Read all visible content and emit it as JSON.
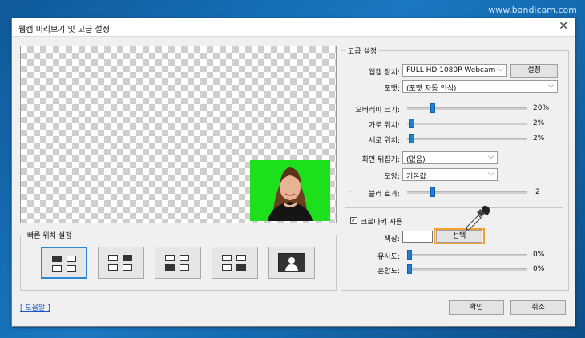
{
  "watermark": "www.bandicam.com",
  "dialog": {
    "title": "웹캠 미리보기 및 고급 설정",
    "close_symbol": "✕"
  },
  "quick_position": {
    "label": "빠른 위치 설정",
    "options": [
      "top-left",
      "top-right",
      "bottom-left",
      "bottom-right",
      "fullscreen"
    ],
    "selected": "top-left"
  },
  "advanced": {
    "label": "고급 설정",
    "webcam_device_label": "웹캠 장치:",
    "webcam_device_value": "FULL HD 1080P Webcam",
    "settings_button": "설정",
    "format_label": "포맷:",
    "format_value": "(포맷 자동 인식)",
    "overlay_size_label": "오버레이 크기:",
    "overlay_size_value": "20%",
    "h_position_label": "가로 위치:",
    "h_position_value": "2%",
    "v_position_label": "세로 위치:",
    "v_position_value": "2%",
    "flip_label": "화면 뒤집기:",
    "flip_value": "(없음)",
    "shape_label": "모양:",
    "shape_value": "기본값",
    "blur_label": "블러 효과:",
    "blur_value": "2",
    "blur_min_mark": "-",
    "chroma_key_label": "크로마키 사용",
    "chroma_key_checked": true,
    "check_mark": "✓",
    "color_label": "색상:",
    "select_button": "선택",
    "similarity_label": "유사도:",
    "similarity_value": "0%",
    "blend_label": "혼합도:",
    "blend_value": "0%",
    "levels": {
      "overlay_size": 0.2,
      "h_position": 0.02,
      "v_position": 0.02,
      "blur": 0.2,
      "similarity": 0.0,
      "blend": 0.0
    }
  },
  "footer": {
    "help_link": "[ 도움말 ]",
    "ok_button": "확인",
    "cancel_button": "취소"
  },
  "colors": {
    "accent": "#1f7fd0",
    "chroma_green": "#1de01d",
    "highlight": "#f0a030"
  }
}
